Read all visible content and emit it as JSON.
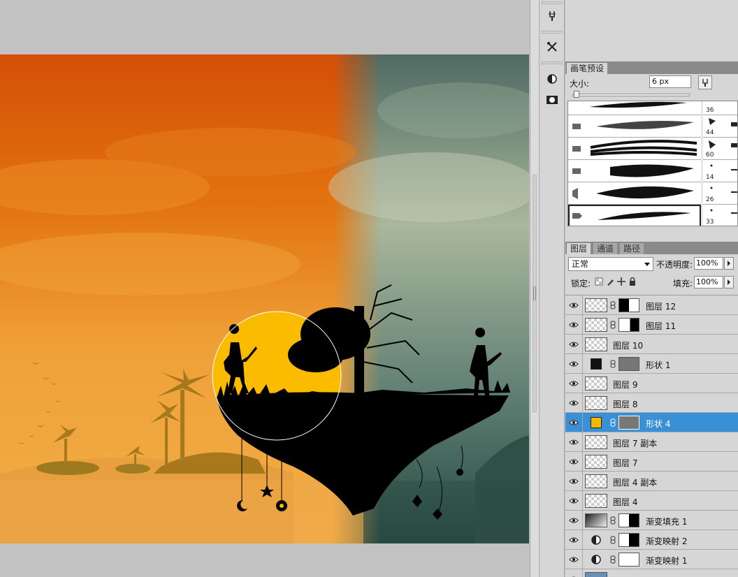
{
  "brush_panel": {
    "tab_label": "画笔预设",
    "size_label": "大小:",
    "size_value": "6 px",
    "brushes": [
      {
        "num": "36"
      },
      {
        "num": "44"
      },
      {
        "num": "60"
      },
      {
        "num": "14"
      },
      {
        "num": "26"
      },
      {
        "num": "33"
      }
    ]
  },
  "layers_panel": {
    "tabs": [
      "图层",
      "通道",
      "路径"
    ],
    "blend_mode": "正常",
    "opacity_label": "不透明度:",
    "opacity_value": "100%",
    "lock_label": "锁定:",
    "fill_label": "填充:",
    "fill_value": "100%",
    "layers": [
      {
        "name": "图层 12",
        "kind": "masked"
      },
      {
        "name": "图层 11",
        "kind": "masked"
      },
      {
        "name": "图层 10",
        "kind": "plain"
      },
      {
        "name": "形状 1",
        "kind": "shape",
        "color": "#111111"
      },
      {
        "name": "图层 9",
        "kind": "plain"
      },
      {
        "name": "图层 8",
        "kind": "plain"
      },
      {
        "name": "形状 4",
        "kind": "shape",
        "color": "#f5b800",
        "selected": true
      },
      {
        "name": "图层 7 副本",
        "kind": "plain"
      },
      {
        "name": "图层 7",
        "kind": "plain"
      },
      {
        "name": "图层 4 副本",
        "kind": "plain"
      },
      {
        "name": "图层 4",
        "kind": "plain"
      },
      {
        "name": "渐变填充 1",
        "kind": "gradient"
      },
      {
        "name": "渐变映射 2",
        "kind": "adjustment"
      },
      {
        "name": "渐变映射 1",
        "kind": "adjustment"
      }
    ]
  },
  "colors": {
    "selection_blue": "#3a90d6",
    "sun_yellow": "#fbbb00",
    "sky_orange": "#d9550a",
    "sky_teal": "#5f7d72"
  }
}
